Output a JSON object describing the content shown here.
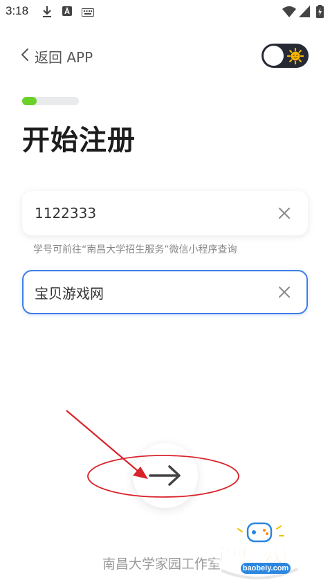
{
  "status_bar": {
    "time": "3:18",
    "icons": [
      "download-icon",
      "a-badge-icon",
      "keyboard-icon",
      "wifi-icon",
      "signal-icon",
      "battery-charging-icon"
    ]
  },
  "header": {
    "back_label": "返回 APP",
    "theme_toggle_icon": "sun-icon"
  },
  "progress": {
    "value": 0.25,
    "color": "#6ad128"
  },
  "title": "开始注册",
  "form": {
    "student_id": {
      "value": "1122333",
      "clear_icon": "close-icon"
    },
    "hint": "学号可前往“南昌大学招生服务”微信小程序查询",
    "name": {
      "value": "宝贝游戏网",
      "clear_icon": "close-icon"
    },
    "focus_color": "#3d7ee6"
  },
  "next_button": {
    "icon": "arrow-right-icon"
  },
  "annotation": {
    "color": "#d9232b"
  },
  "footer": "南昌大学家园工作室",
  "watermark": {
    "text": "宝贝游戏网",
    "url": "baobeiy.com"
  }
}
